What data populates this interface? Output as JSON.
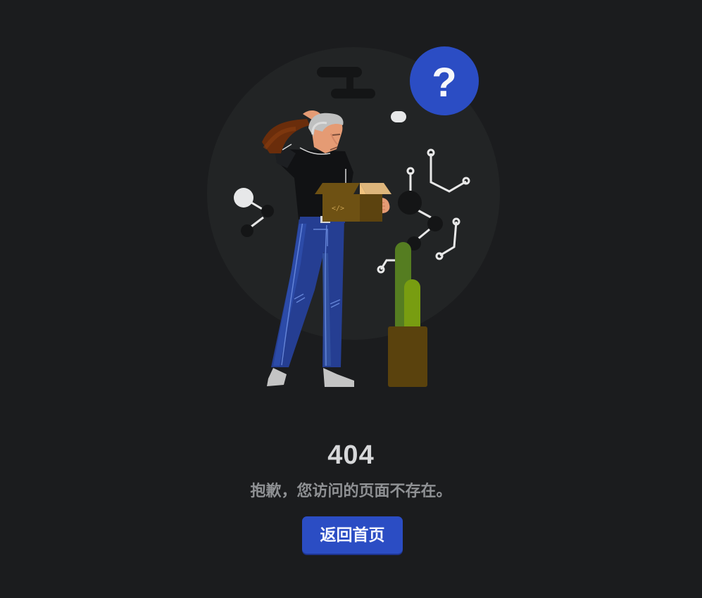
{
  "error": {
    "code": "404",
    "message": "抱歉，您访问的页面不存在。"
  },
  "actions": {
    "home_label": "返回首页"
  },
  "illustration": {
    "question_icon": "?",
    "box_icon": "</>",
    "icons": [
      "question-mark-icon",
      "code-box-icon",
      "network-node-icon",
      "plant-icon"
    ],
    "colors": {
      "background": "#1b1c1e",
      "circle": "#222425",
      "accent": "#2b4dc4",
      "plant_dark": "#557d21",
      "plant_light": "#789d11",
      "pot": "#5a420d",
      "box": "#6e5113"
    }
  }
}
